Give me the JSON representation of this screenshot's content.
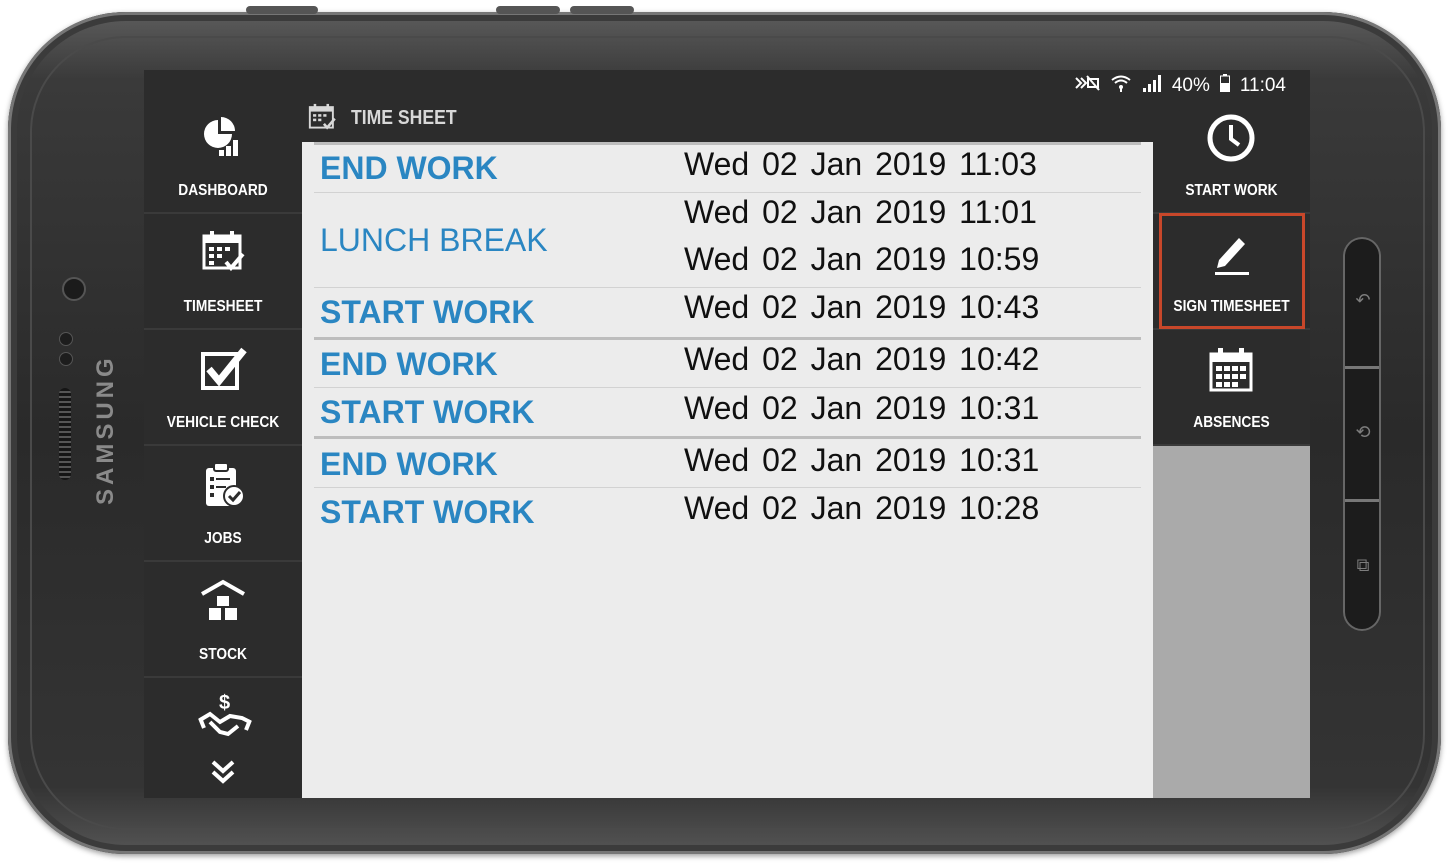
{
  "status_bar": {
    "battery": "40%",
    "time": "11:04"
  },
  "left_menu": {
    "items": [
      {
        "label": "DASHBOARD",
        "icon": "dashboard-chart-icon"
      },
      {
        "label": "TIMESHEET",
        "icon": "calendar-check-icon"
      },
      {
        "label": "VEHICLE CHECK",
        "icon": "checkbox-icon"
      },
      {
        "label": "JOBS",
        "icon": "clipboard-check-icon"
      },
      {
        "label": "STOCK",
        "icon": "stock-boxes-icon"
      },
      {
        "label": "",
        "icon": "handshake-dollar-icon"
      }
    ],
    "more_icon": "double-chevron-down-icon"
  },
  "timesheet": {
    "title": "TIME SHEET",
    "entries": [
      {
        "action": "END WORK",
        "time": "Wed 02 Jan 2019 11:03"
      },
      {
        "action": "LUNCH BREAK",
        "time_end": "Wed 02 Jan 2019 11:01",
        "time_start": "Wed 02 Jan 2019 10:59"
      },
      {
        "action": "START WORK",
        "time": "Wed 02 Jan 2019 10:43"
      },
      {
        "action": "END WORK",
        "time": "Wed 02 Jan 2019 10:42"
      },
      {
        "action": "START WORK",
        "time": "Wed 02 Jan 2019 10:31"
      },
      {
        "action": "END WORK",
        "time": "Wed 02 Jan 2019 10:31"
      },
      {
        "action": "START WORK",
        "time": "Wed 02 Jan 2019 10:28"
      }
    ]
  },
  "right_menu": {
    "items": [
      {
        "label": "START WORK",
        "icon": "clock-icon"
      },
      {
        "label": "SIGN TIMESHEET",
        "icon": "pencil-sign-icon",
        "highlighted": true
      },
      {
        "label": "ABSENCES",
        "icon": "calendar-grid-icon"
      }
    ]
  },
  "device": {
    "brand": "SAMSUNG"
  },
  "colors": {
    "accent": "#2a86c2",
    "highlight_border": "#c8472a",
    "menu_bg": "#2c2c2c",
    "panel_bg": "#ececec"
  }
}
